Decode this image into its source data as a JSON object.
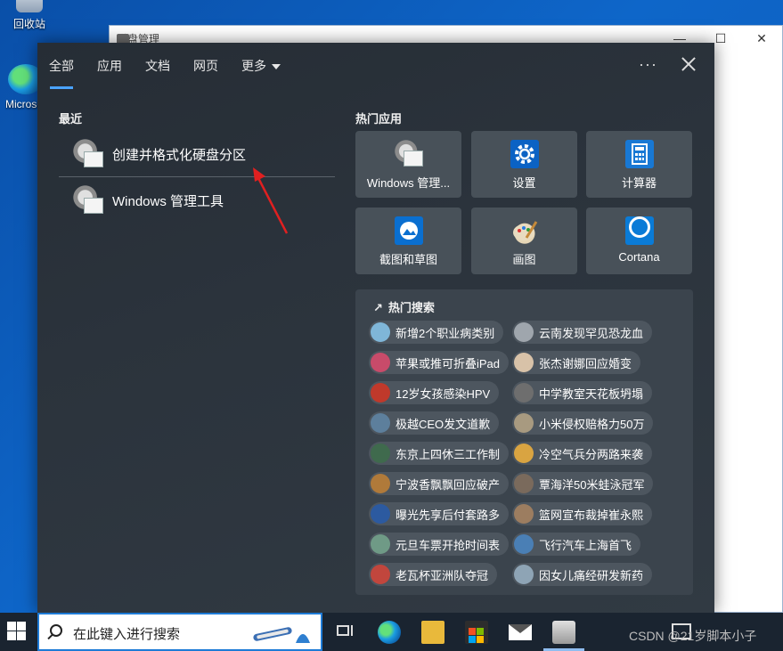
{
  "desktop": {
    "icons": [
      {
        "label": "回收站"
      },
      {
        "label": "Microsoft Edge"
      }
    ]
  },
  "disk_window": {
    "title": "磁盘管理",
    "controls": [
      "—",
      "☐",
      "✕"
    ]
  },
  "search_panel": {
    "tabs": [
      {
        "label": "全部",
        "active": true
      },
      {
        "label": "应用"
      },
      {
        "label": "文档"
      },
      {
        "label": "网页"
      },
      {
        "label": "更多"
      }
    ],
    "more_options": "···",
    "recent": {
      "title": "最近",
      "items": [
        {
          "label": "创建并格式化硬盘分区",
          "icon": "admin-tools-icon"
        },
        {
          "label": "Windows 管理工具",
          "icon": "admin-tools-icon"
        }
      ]
    },
    "hot_apps": {
      "title": "热门应用",
      "items": [
        {
          "label": "Windows 管理...",
          "icon": "admin-tools-icon"
        },
        {
          "label": "设置",
          "icon": "gear-icon"
        },
        {
          "label": "计算器",
          "icon": "calculator-icon"
        },
        {
          "label": "截图和草图",
          "icon": "snip-sketch-icon"
        },
        {
          "label": "画图",
          "icon": "paint-icon"
        },
        {
          "label": "Cortana",
          "icon": "cortana-icon"
        }
      ]
    },
    "hot_search": {
      "title": "热门搜索",
      "items": [
        {
          "label": "新增2个职业病类别",
          "color": "#7fb6d8"
        },
        {
          "label": "云南发现罕见恐龙血",
          "color": "#9fa6ad"
        },
        {
          "label": "苹果或推可折叠iPad",
          "color": "#c84b6a"
        },
        {
          "label": "张杰谢娜回应婚变",
          "color": "#d8c2a8"
        },
        {
          "label": "12岁女孩感染HPV",
          "color": "#c0392b"
        },
        {
          "label": "中学教室天花板坍塌",
          "color": "#6e6e6e"
        },
        {
          "label": "极越CEO发文道歉",
          "color": "#5d7f9c"
        },
        {
          "label": "小米侵权赔格力50万",
          "color": "#a89a80"
        },
        {
          "label": "东京上四休三工作制",
          "color": "#3f6a4d"
        },
        {
          "label": "冷空气兵分两路来袭",
          "color": "#d9a441"
        },
        {
          "label": "宁波香飘飘回应破产",
          "color": "#b07a3a"
        },
        {
          "label": "覃海洋50米蛙泳冠军",
          "color": "#7a6a5c"
        },
        {
          "label": "曝光先享后付套路多",
          "color": "#2c5aa0"
        },
        {
          "label": "篮网宣布裁掉崔永熙",
          "color": "#9c7d60"
        },
        {
          "label": "元旦车票开抢时间表",
          "color": "#6f9a86"
        },
        {
          "label": "飞行汽车上海首飞",
          "color": "#4a7fb5"
        },
        {
          "label": "老瓦杯亚洲队夺冠",
          "color": "#c1463d"
        },
        {
          "label": "因女儿痛经研发新药",
          "color": "#8ea4b5"
        }
      ]
    },
    "colors": {
      "accent": "#4aa3ff",
      "panel_bg": "#2b333c",
      "tile_bg": "#485159"
    }
  },
  "taskbar": {
    "search_placeholder": "在此键入进行搜索",
    "watermark": "CSDN @21岁脚本小子",
    "pinned": [
      "task-view-icon",
      "edge-icon",
      "file-explorer-icon",
      "store-icon",
      "mail-icon",
      "disk-management-icon"
    ]
  }
}
